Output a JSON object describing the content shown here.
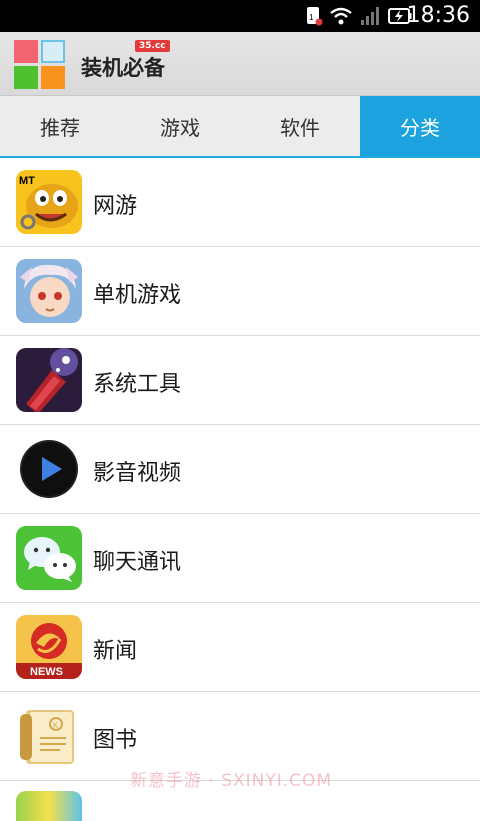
{
  "status_bar": {
    "time": "18:36"
  },
  "app": {
    "title": "装机必备",
    "badge": "35.cc"
  },
  "tabs": [
    {
      "label": "推荐",
      "active": false
    },
    {
      "label": "游戏",
      "active": false
    },
    {
      "label": "软件",
      "active": false
    },
    {
      "label": "分类",
      "active": true
    }
  ],
  "categories": [
    {
      "label": "网游",
      "icon": "monster-game-icon"
    },
    {
      "label": "单机游戏",
      "icon": "anime-character-icon"
    },
    {
      "label": "系统工具",
      "icon": "flashlight-icon"
    },
    {
      "label": "影音视频",
      "icon": "play-icon"
    },
    {
      "label": "聊天通讯",
      "icon": "wechat-icon"
    },
    {
      "label": "新闻",
      "icon": "news-icon"
    },
    {
      "label": "图书",
      "icon": "book-icon"
    }
  ],
  "watermark": "新意手游 · SXINYI.COM",
  "colors": {
    "accent": "#1ca2de"
  }
}
